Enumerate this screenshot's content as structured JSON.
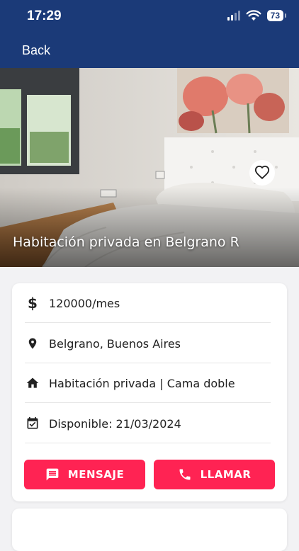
{
  "status": {
    "time": "17:29",
    "battery": "73"
  },
  "header": {
    "back_label": "Back"
  },
  "hero": {
    "title": "Habitación privada en Belgrano R"
  },
  "details": {
    "price": "120000/mes",
    "location": "Belgrano, Buenos Aires",
    "room": "Habitación privada | Cama doble",
    "available": "Disponible: 21/03/2024"
  },
  "actions": {
    "message_label": "MENSAJE",
    "call_label": "LLAMAR"
  },
  "colors": {
    "header": "#1b3a78",
    "accent": "#ff2353",
    "background": "#f2f2f4"
  }
}
